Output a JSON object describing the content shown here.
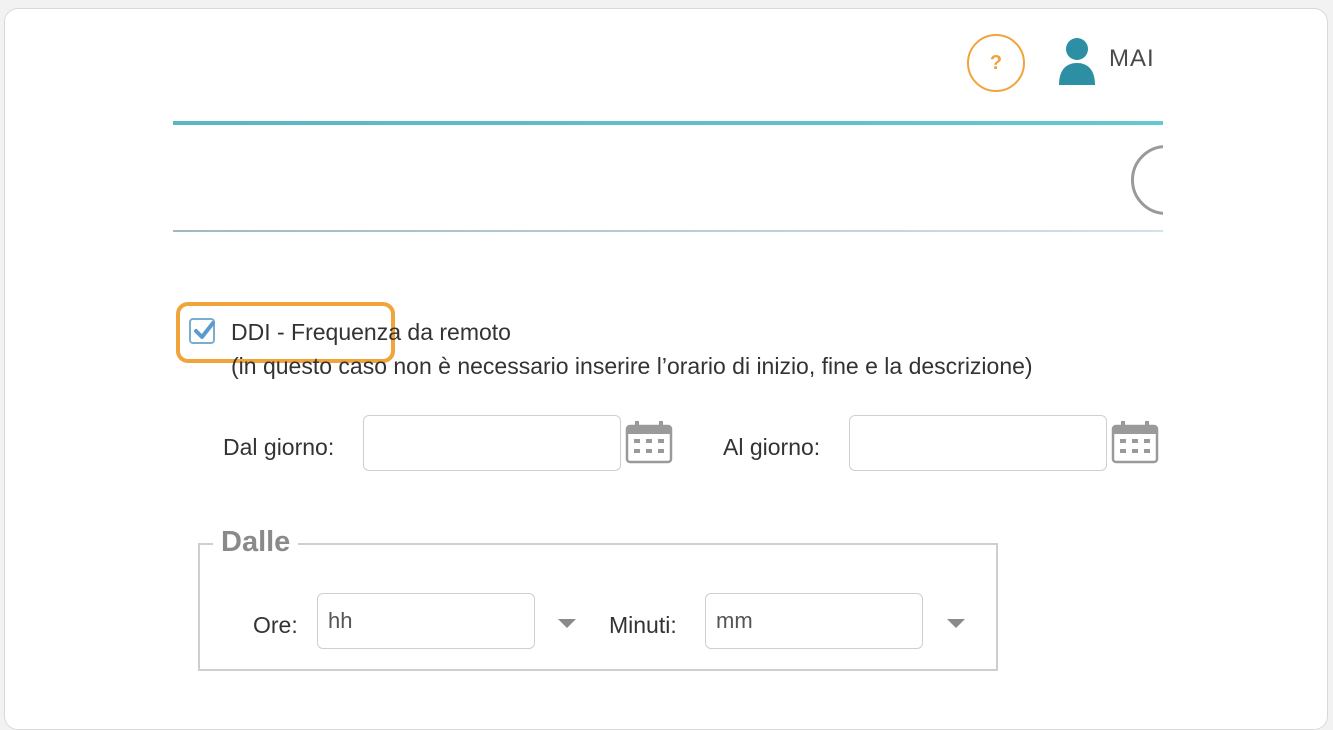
{
  "header": {
    "help_label": "?",
    "user_name": "MAI"
  },
  "ddi": {
    "checked": true,
    "label": "DDI - Frequenza da remoto",
    "note": "(in questo caso non è necessario inserire l’orario di inizio, fine e la descrizione)"
  },
  "dates": {
    "from_label": "Dal giorno:",
    "from_value": "",
    "to_label": "Al giorno:",
    "to_value": ""
  },
  "time_from": {
    "legend": "Dalle",
    "hours_label": "Ore:",
    "hours_placeholder": "hh",
    "minutes_label": "Minuti:",
    "minutes_placeholder": "mm"
  },
  "colors": {
    "accent_orange": "#f0a43a",
    "teal": "#3aa7b5",
    "checkbox_blue": "#5b9bd0"
  }
}
